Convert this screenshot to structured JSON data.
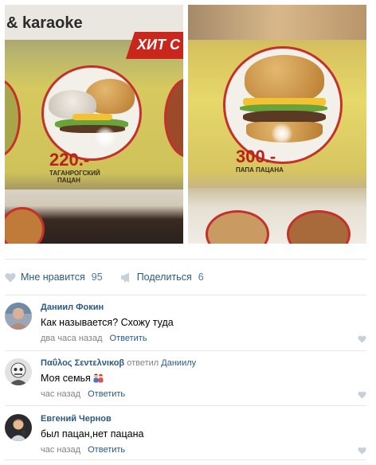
{
  "photos": {
    "left": {
      "sign_text": "& karaoke",
      "banner_text": "ХИТ С",
      "price": "220.-",
      "name_line1": "ТАГАНРОГСКИЙ",
      "name_line2": "ПАЦАН"
    },
    "right": {
      "price": "300.-",
      "name_line1": "ПАПА ПАЦАНА"
    }
  },
  "actions": {
    "like_label": "Мне нравится",
    "like_count": "95",
    "share_label": "Поделиться",
    "share_count": "6",
    "colors": {
      "link": "#2a5885",
      "count": "#4a76a8",
      "icon": "#c5d0db"
    }
  },
  "comments": [
    {
      "author": "Даниил Фокин",
      "reply_to": "",
      "text": "Как называется? Схожу туда",
      "time": "два часа назад",
      "reply_label": "Ответить",
      "emoji": ""
    },
    {
      "author": "Παΰλος Σεντελνικοβ",
      "reply_prefix": "ответил",
      "reply_to": "Даниилу",
      "text": "Моя семья",
      "time": "час назад",
      "reply_label": "Ответить",
      "emoji": "family-emoji"
    },
    {
      "author": "Евгений Чернов",
      "reply_to": "",
      "text": "был пацан,нет пацана",
      "time": "час назад",
      "reply_label": "Ответить",
      "emoji": ""
    }
  ]
}
